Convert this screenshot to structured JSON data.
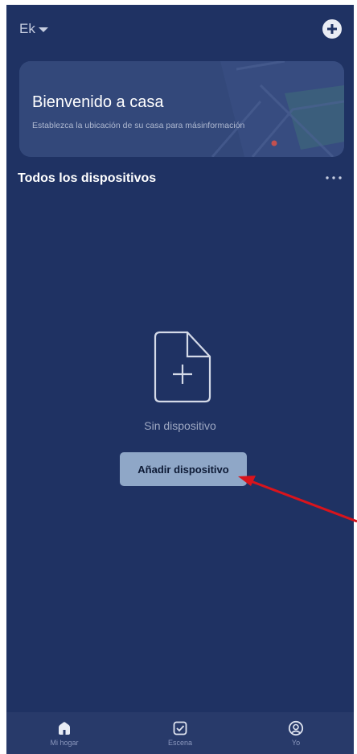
{
  "header": {
    "home_name": "Ek"
  },
  "welcome_card": {
    "title": "Bienvenido a casa",
    "subtitle": "Establezca la ubicación de su casa para másinformación"
  },
  "devices_section": {
    "title": "Todos los dispositivos"
  },
  "empty_state": {
    "message": "Sin dispositivo",
    "button_label": "Añadir dispositivo"
  },
  "tabbar": {
    "tabs": [
      {
        "label": "Mi hogar",
        "icon": "home-icon",
        "active": true
      },
      {
        "label": "Escena",
        "icon": "scene-checkbox-icon",
        "active": false
      },
      {
        "label": "Yo",
        "icon": "profile-icon",
        "active": false
      }
    ]
  },
  "colors": {
    "background": "#1f3263",
    "card": "#33487a",
    "button": "#8fa7c7",
    "annotation_arrow": "#d9141c",
    "tabbar": "#283a6a"
  }
}
